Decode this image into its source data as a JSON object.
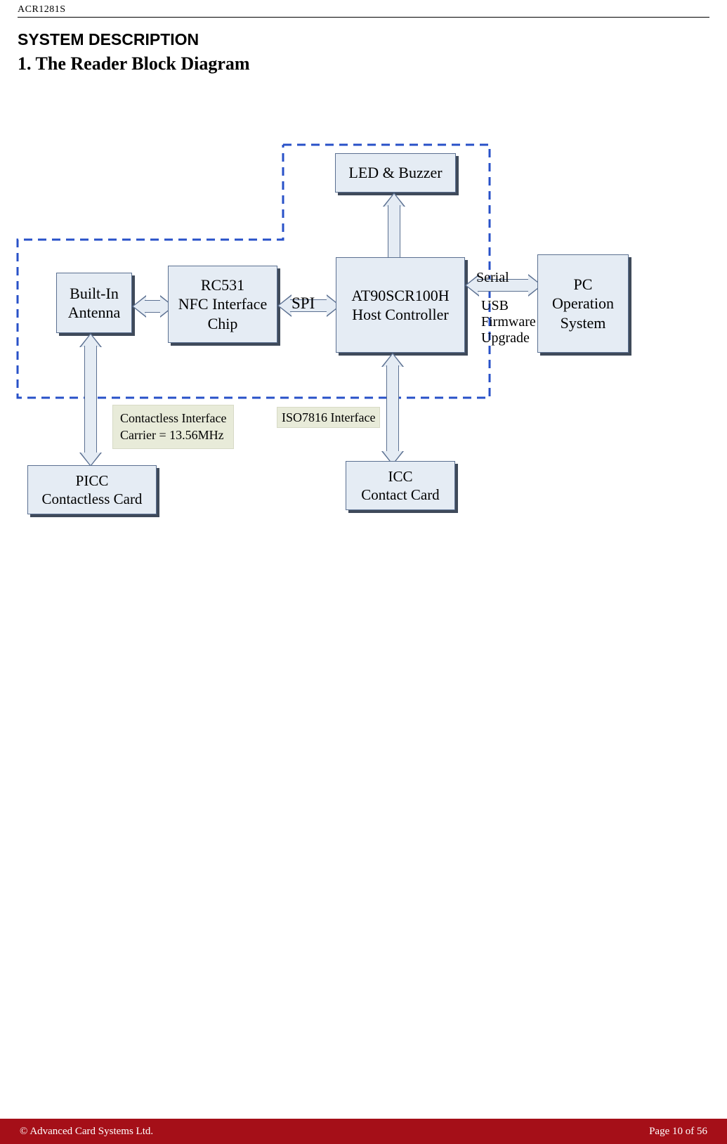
{
  "header": {
    "doc_id": "ACR1281S"
  },
  "section": {
    "title": "SYSTEM DESCRIPTION",
    "chapter": "1. The Reader Block Diagram"
  },
  "blocks": {
    "led_buzzer": "LED & Buzzer",
    "antenna_l1": "Built-In",
    "antenna_l2": "Antenna",
    "nfc_l1": "RC531",
    "nfc_l2": "NFC Interface",
    "nfc_l3": "Chip",
    "host_l1": "AT90SCR100H",
    "host_l2": "Host Controller",
    "pc_l1": "PC",
    "pc_l2": "Operation",
    "pc_l3": "System",
    "picc_l1": "PICC",
    "picc_l2": "Contactless Card",
    "icc_l1": "ICC",
    "icc_l2": "Contact Card"
  },
  "labels": {
    "spi": "SPI",
    "serial": "Serial",
    "usb_l1": "USB",
    "usb_l2": "Firmware",
    "usb_l3": "Upgrade",
    "iso7816": "ISO7816 Interface",
    "contactless_l1": "Contactless Interface",
    "contactless_l2": "Carrier = 13.56MHz"
  },
  "footer": {
    "left": "© Advanced Card Systems Ltd.",
    "right": "Page 10 of 56"
  }
}
